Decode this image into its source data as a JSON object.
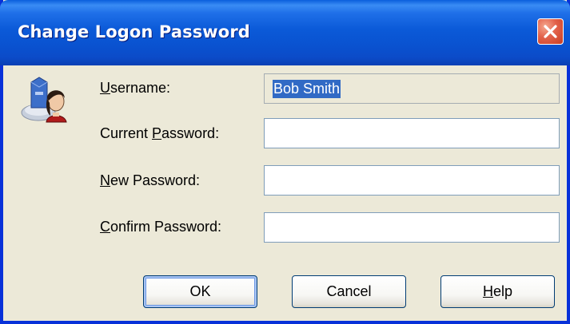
{
  "window": {
    "title": "Change Logon Password",
    "close_icon": "close-x-icon"
  },
  "icon": {
    "name": "user-key-icon"
  },
  "form": {
    "username": {
      "label_pre": "",
      "label_key": "U",
      "label_post": "sername:",
      "value": "Bob Smith"
    },
    "current_password": {
      "label_pre": "Current ",
      "label_key": "P",
      "label_post": "assword:",
      "value": ""
    },
    "new_password": {
      "label_pre": "",
      "label_key": "N",
      "label_post": "ew Password:",
      "value": ""
    },
    "confirm_password": {
      "label_pre": "",
      "label_key": "C",
      "label_post": "onfirm Password:",
      "value": ""
    }
  },
  "buttons": {
    "ok": "OK",
    "cancel": "Cancel",
    "help_pre": "",
    "help_key": "H",
    "help_post": "elp"
  },
  "colors": {
    "title_bar": "#0a52d0",
    "selection": "#316ac5",
    "close_button": "#e2614a"
  }
}
